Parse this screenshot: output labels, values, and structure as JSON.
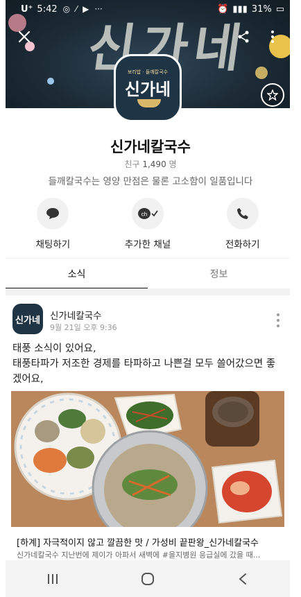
{
  "status_bar": {
    "carrier": "U⁺",
    "time": "5:42",
    "battery": "31%"
  },
  "channel": {
    "name": "신가네칼국수",
    "friends_label": "친구",
    "friends_count": "1,490",
    "friends_unit": "명",
    "description": "들깨칼국수는 영양 만점은 물론 고소함이 일품입니다",
    "logo_small_text": "보리밥 · 들깨칼국수",
    "logo_main_text": "신가네",
    "cover_text": "신가네"
  },
  "actions": [
    {
      "label": "채팅하기",
      "icon": "chat-bubble-icon"
    },
    {
      "label": "추가한 채널",
      "icon": "channel-added-icon"
    },
    {
      "label": "전화하기",
      "icon": "phone-icon"
    }
  ],
  "tabs": [
    {
      "label": "소식",
      "active": true
    },
    {
      "label": "정보",
      "active": false
    }
  ],
  "post": {
    "author": "신가네칼국수",
    "date": "9월 21일 오후 9:36",
    "avatar_text": "신가네",
    "body": "태풍 소식이 있어요,\n태풍타파가 저조한 경제를 타파하고 나쁜걸 모두 쓸어갔으면 좋겠어요,",
    "link_title": "[하계] 자극적이지 않고 깔끔한 맛 / 가성비 끝판왕_신가네칼국수",
    "link_desc": "신가네칼국수 지난번에 제이가 아파서 새벽에 #을지병원 응급실에 갔을 때..."
  },
  "colors": {
    "cover_bg": "#1c2b36",
    "accent_text": "#111111",
    "tab_indicator": "#111111"
  }
}
